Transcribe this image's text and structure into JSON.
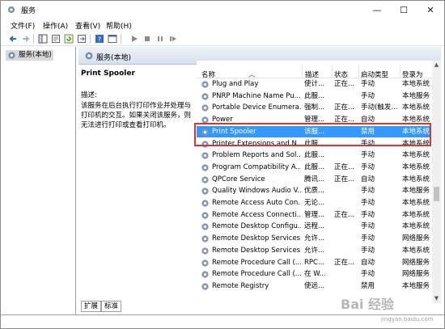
{
  "window": {
    "title": "服务",
    "minimize_glyph": "—",
    "maximize_glyph": "☐",
    "close_glyph": "✕"
  },
  "menu": [
    "文件(F)",
    "操作(A)",
    "查看(V)",
    "帮助(H)"
  ],
  "toolbar": {
    "icons": [
      "back-icon",
      "forward-icon",
      "console-tree-icon",
      "properties-icon",
      "refresh-icon",
      "export-icon",
      "help-icon",
      "console-icon",
      "start-icon",
      "stop-icon",
      "pause-icon",
      "restart-icon"
    ]
  },
  "tree": {
    "root_label": "服务(本地)"
  },
  "content_header": {
    "label": "服务(本地)"
  },
  "details": {
    "service_name": "Print Spooler",
    "desc_label": "描述:",
    "desc_text": "该服务在后台执行打印作业并处理与打印机的交互。如果关闭该服务，则无法进行打印或查看打印机。"
  },
  "columns": {
    "name": "名称",
    "description": "描述",
    "status": "状态",
    "startup": "启动类型",
    "logon": "登录为"
  },
  "services": [
    {
      "name": "Plug and Play",
      "desc": "使计...",
      "status": "正在...",
      "startup": "手动",
      "logon": "本地系统"
    },
    {
      "name": "PNRP Machine Name Pu...",
      "desc": "此服...",
      "status": "",
      "startup": "手动",
      "logon": "本地服务"
    },
    {
      "name": "Portable Device Enumera...",
      "desc": "强制...",
      "status": "正在...",
      "startup": "手动(触发...",
      "logon": "本地系统"
    },
    {
      "name": "Power",
      "desc": "管理...",
      "status": "正在...",
      "startup": "自动",
      "logon": "本地系统"
    },
    {
      "name": "Print Spooler",
      "desc": "该服...",
      "status": "",
      "startup": "禁用",
      "logon": "本地系统"
    },
    {
      "name": "Printer Extensions and N...",
      "desc": "此服...",
      "status": "",
      "startup": "手动",
      "logon": "本地系统"
    },
    {
      "name": "Problem Reports and Sol...",
      "desc": "此服...",
      "status": "",
      "startup": "手动",
      "logon": "本地系统"
    },
    {
      "name": "Program Compatibility A...",
      "desc": "此服...",
      "status": "正在...",
      "startup": "手动",
      "logon": "本地系统"
    },
    {
      "name": "QPCore Service",
      "desc": "腾讯...",
      "status": "正在...",
      "startup": "自动",
      "logon": "本地系统"
    },
    {
      "name": "Quality Windows Audio V...",
      "desc": "优质...",
      "status": "",
      "startup": "手动",
      "logon": "本地服务"
    },
    {
      "name": "Remote Access Auto Con...",
      "desc": "无论...",
      "status": "",
      "startup": "手动",
      "logon": "本地系统"
    },
    {
      "name": "Remote Access Connecti...",
      "desc": "管理...",
      "status": "正在...",
      "startup": "手动",
      "logon": "本地系统"
    },
    {
      "name": "Remote Desktop Configu...",
      "desc": "远程...",
      "status": "",
      "startup": "手动",
      "logon": "本地系统"
    },
    {
      "name": "Remote Desktop Services",
      "desc": "允许...",
      "status": "",
      "startup": "手动",
      "logon": "网络服务"
    },
    {
      "name": "Remote Desktop Services ...",
      "desc": "允许...",
      "status": "",
      "startup": "手动",
      "logon": "本地系统"
    },
    {
      "name": "Remote Procedure Call (...",
      "desc": "RPC...",
      "status": "正在...",
      "startup": "自动",
      "logon": "网络服务"
    },
    {
      "name": "Remote Procedure Call (...",
      "desc": "在 W...",
      "status": "",
      "startup": "手动",
      "logon": "网络服务"
    },
    {
      "name": "Remote Registry",
      "desc": "使远...",
      "status": "",
      "startup": "禁用",
      "logon": "本地服务"
    }
  ],
  "selected_index": 4,
  "tabs": [
    "扩展",
    "标准"
  ],
  "watermark": {
    "text": "Bai 经验",
    "sub": "jingyan.baidu.com"
  },
  "colors": {
    "selection": "#3399ff",
    "highlight_box": "#e0332e"
  }
}
